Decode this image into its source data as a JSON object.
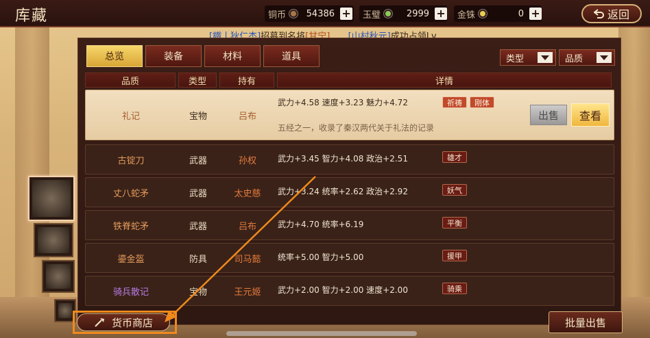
{
  "header": {
    "title": "库藏",
    "back_label": "返回",
    "resources": [
      {
        "label": "铜币",
        "value": "54386",
        "color": "#a5784a"
      },
      {
        "label": "玉璧",
        "value": "2999",
        "color": "#8acb5b"
      },
      {
        "label": "金铢",
        "value": "0",
        "color": "#e7cf56"
      }
    ]
  },
  "notice": {
    "p1": "[鐵丨狄仁杰]",
    "p2": "招募到名将",
    "p3": "[甘宁]",
    "p4": "[山村秋元]",
    "p5": "成功占领Lv"
  },
  "tabs": [
    "总览",
    "装备",
    "材料",
    "道具"
  ],
  "active_tab": 0,
  "filters": [
    "类型",
    "品质"
  ],
  "columns": [
    "品质",
    "类型",
    "持有",
    "详情"
  ],
  "items": [
    {
      "name": "礼记",
      "type": "宝物",
      "holder": "吕布",
      "stats": "武力+4.58  速度+3.23  魅力+4.72",
      "tags": [
        "祈祷",
        "刚体"
      ],
      "desc": "五经之一，收录了秦汉两代关于礼法的记录",
      "quality": "gold"
    },
    {
      "name": "古锭刀",
      "type": "武器",
      "holder": "孙权",
      "stats": "武力+3.45  智力+4.08  政治+2.51",
      "tags": [
        "雄才"
      ],
      "quality": "gold"
    },
    {
      "name": "丈八蛇矛",
      "type": "武器",
      "holder": "太史慈",
      "stats": "武力+3.24  统率+2.62  政治+2.92",
      "tags": [
        "妖气"
      ],
      "quality": "gold"
    },
    {
      "name": "铁脊蛇矛",
      "type": "武器",
      "holder": "吕布",
      "stats": "武力+4.70  统率+6.19",
      "tags": [
        "平衡"
      ],
      "quality": "gold"
    },
    {
      "name": "鎏金盔",
      "type": "防具",
      "holder": "司马懿",
      "stats": "统率+5.00  智力+5.00",
      "tags": [
        "援甲"
      ],
      "quality": "gold"
    },
    {
      "name": "骑兵散记",
      "type": "宝物",
      "holder": "王元姬",
      "stats": "武力+2.00  智力+2.00  速度+2.00",
      "tags": [
        "骑乘"
      ],
      "quality": "purple"
    }
  ],
  "buttons": {
    "sell": "出售",
    "view": "查看",
    "shop": "货币商店",
    "batch_sell": "批量出售"
  },
  "colors": {
    "accent_gold": "#f0b73f",
    "highlight_orange": "#f08a1c"
  }
}
